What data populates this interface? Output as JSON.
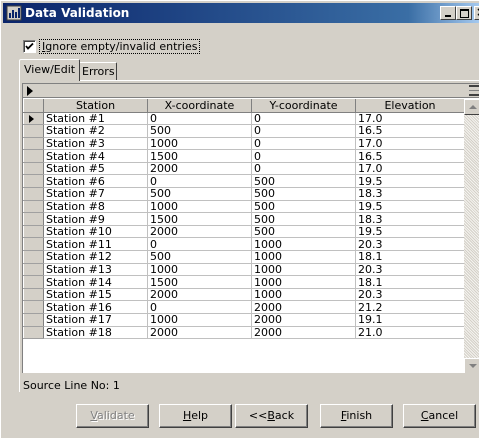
{
  "window": {
    "title": "Data Validation",
    "accent": "#0a246a"
  },
  "options": {
    "ignore_empty_label_u": "I",
    "ignore_empty_label_rest": "gnore empty/invalid entries",
    "ignore_empty_checked": true
  },
  "tabs": [
    {
      "label": "View/Edit",
      "active": true
    },
    {
      "label": "Errors",
      "active": false
    }
  ],
  "table": {
    "columns": [
      "Station",
      "X-coordinate",
      "Y-coordinate",
      "Elevation"
    ],
    "rows": [
      [
        "Station #1",
        "0",
        "0",
        "17.0"
      ],
      [
        "Station #2",
        "500",
        "0",
        "16.5"
      ],
      [
        "Station #3",
        "1000",
        "0",
        "17.0"
      ],
      [
        "Station #4",
        "1500",
        "0",
        "16.5"
      ],
      [
        "Station #5",
        "2000",
        "0",
        "17.0"
      ],
      [
        "Station #6",
        "0",
        "500",
        "19.5"
      ],
      [
        "Station #7",
        "500",
        "500",
        "18.3"
      ],
      [
        "Station #8",
        "1000",
        "500",
        "19.5"
      ],
      [
        "Station #9",
        "1500",
        "500",
        "18.3"
      ],
      [
        "Station #10",
        "2000",
        "500",
        "19.5"
      ],
      [
        "Station #11",
        "0",
        "1000",
        "20.3"
      ],
      [
        "Station #12",
        "500",
        "1000",
        "18.1"
      ],
      [
        "Station #13",
        "1000",
        "1000",
        "20.3"
      ],
      [
        "Station #14",
        "1500",
        "1000",
        "18.1"
      ],
      [
        "Station #15",
        "2000",
        "1000",
        "20.3"
      ],
      [
        "Station #16",
        "0",
        "2000",
        "21.2"
      ],
      [
        "Station #17",
        "1000",
        "2000",
        "19.1"
      ],
      [
        "Station #18",
        "2000",
        "2000",
        "21.0"
      ]
    ],
    "current_row": 0
  },
  "status": {
    "source_line": "Source Line No: 1"
  },
  "buttons": {
    "validate": {
      "u": "V",
      "rest": "alidate",
      "enabled": false
    },
    "help": {
      "u": "H",
      "rest": "elp"
    },
    "back": {
      "pre": "<<",
      "u": "B",
      "rest": "ack"
    },
    "finish": {
      "u": "F",
      "rest": "inish"
    },
    "cancel": {
      "u": "C",
      "rest": "ancel"
    }
  }
}
